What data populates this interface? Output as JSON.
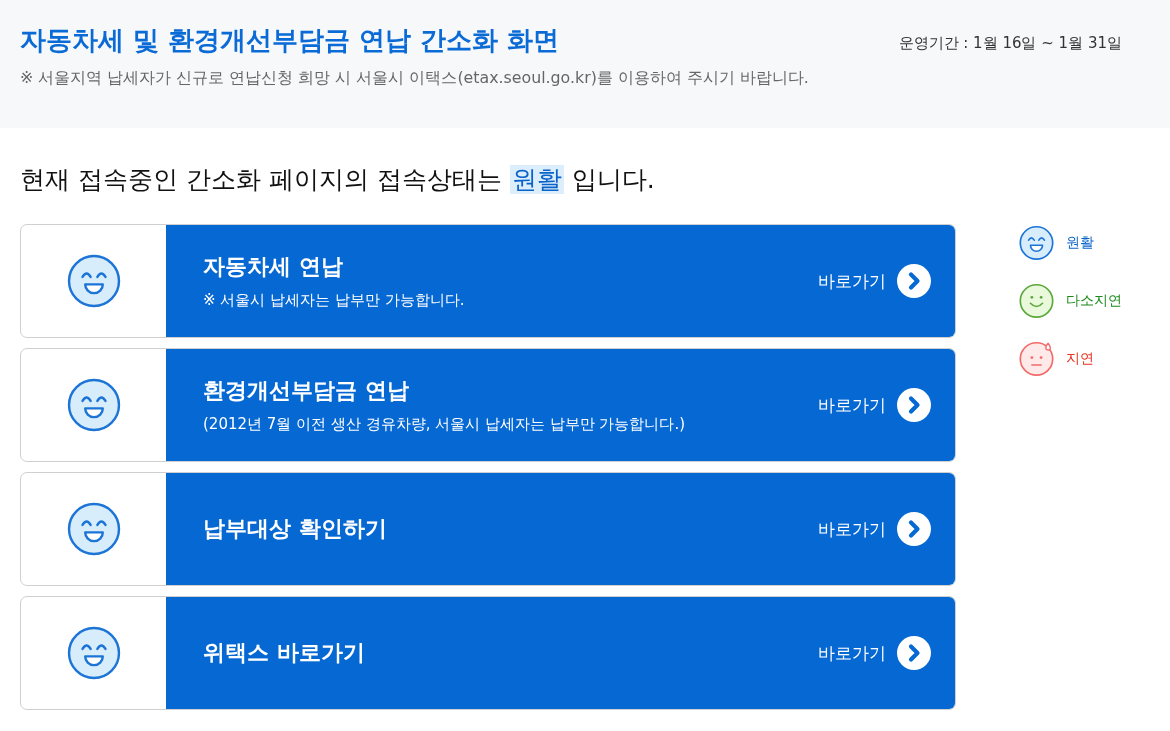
{
  "header": {
    "title": "자동차세 및 환경개선부담금 연납 간소화 화면",
    "period": "운영기간 : 1월 16일 ~ 1월 31일",
    "notice": "※ 서울지역 납세자가 신규로 연납신청 희망 시 서울시 이택스(etax.seoul.go.kr)를 이용하여 주시기 바랍니다."
  },
  "status_message": {
    "prefix": "현재 접속중인 간소화 페이지의 접속상태는",
    "status": "원활",
    "kind": "smooth",
    "suffix": "입니다."
  },
  "services": [
    {
      "title": "자동차세 연납",
      "note": "※ 서울시 납세자는 납부만 가능합니다.",
      "link": "바로가기",
      "kind": "smooth"
    },
    {
      "title": "환경개선부담금 연납",
      "note": "(2012년 7월 이전 생산 경유차량, 서울시 납세자는 납부만 가능합니다.)",
      "link": "바로가기",
      "kind": "smooth"
    },
    {
      "title": "납부대상 확인하기",
      "link": "바로가기",
      "kind": "smooth"
    },
    {
      "title": "위택스 바로가기",
      "link": "바로가기",
      "kind": "smooth"
    }
  ],
  "legend": [
    {
      "kind": "smooth",
      "label": "원활",
      "color": "#0a63c9"
    },
    {
      "kind": "moderate",
      "label": "다소지연",
      "color": "#1b8a1b"
    },
    {
      "kind": "delayed",
      "label": "지연",
      "color": "#e8301c"
    }
  ]
}
